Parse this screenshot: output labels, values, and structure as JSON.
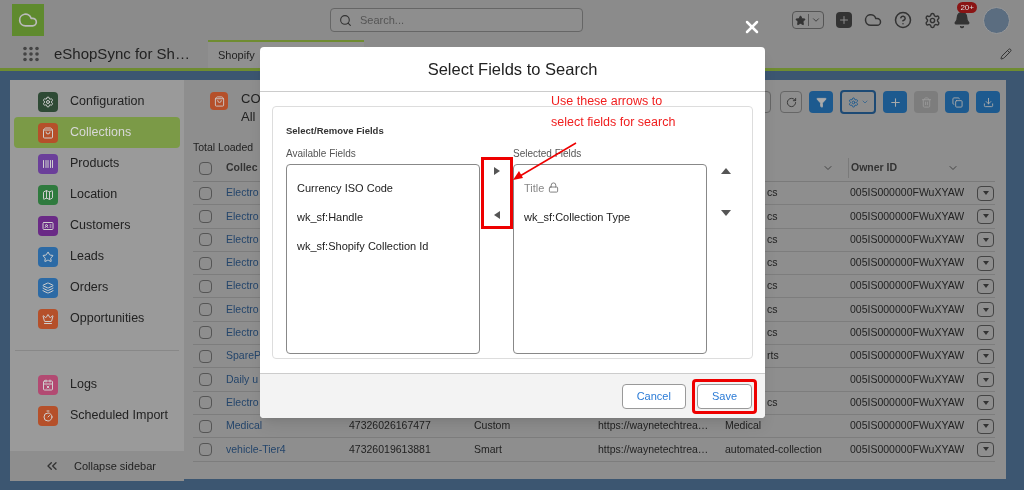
{
  "header": {
    "search": {
      "placeholder": "Search..."
    },
    "notification_badge": "20+"
  },
  "nav": {
    "app_name": "eShopSync for Sh…",
    "tabs": [
      {
        "label": "Shopify",
        "selected": true
      }
    ]
  },
  "sidebar": {
    "items": [
      {
        "label": "Configuration",
        "selected": false,
        "color": "#2e4a35"
      },
      {
        "label": "Collections",
        "selected": true,
        "color": "#b5502a"
      },
      {
        "label": "Products",
        "selected": false,
        "color": "#6b3f9a"
      },
      {
        "label": "Location",
        "selected": false,
        "color": "#2f7a3e"
      },
      {
        "label": "Customers",
        "selected": false,
        "color": "#6a2a86"
      },
      {
        "label": "Leads",
        "selected": false,
        "color": "#2c6aa5"
      },
      {
        "label": "Orders",
        "selected": false,
        "color": "#2c6aa5"
      },
      {
        "label": "Opportunities",
        "selected": false,
        "color": "#b5502a"
      }
    ],
    "footer_items": [
      {
        "label": "Logs",
        "selected": false,
        "color": "#b24a72"
      },
      {
        "label": "Scheduled Import",
        "selected": false,
        "color": "#b5502a"
      }
    ],
    "collapse": "Collapse sidebar"
  },
  "main": {
    "title": "CO",
    "subtitle": "All",
    "total_loaded": "Total Loaded"
  },
  "table": {
    "select_all": {
      "checked": false
    },
    "columns": [
      {
        "label": "Collec"
      },
      {
        "label": "Owner ID"
      }
    ],
    "rows": [
      {
        "checked": false,
        "name": "Electro",
        "col_5": "cs",
        "owner_id": "005IS000000FWuXYAW"
      },
      {
        "checked": false,
        "name": "Electro",
        "col_5": "cs",
        "owner_id": "005IS000000FWuXYAW"
      },
      {
        "checked": false,
        "name": "Electro",
        "col_5": "cs",
        "owner_id": "005IS000000FWuXYAW"
      },
      {
        "checked": false,
        "name": "Electro",
        "col_5": "cs",
        "owner_id": "005IS000000FWuXYAW"
      },
      {
        "checked": false,
        "name": "Electro",
        "col_5": "cs",
        "owner_id": "005IS000000FWuXYAW"
      },
      {
        "checked": false,
        "name": "Electro",
        "col_5": "cs",
        "owner_id": "005IS000000FWuXYAW"
      },
      {
        "checked": false,
        "name": "Electro",
        "col_5": "cs",
        "owner_id": "005IS000000FWuXYAW"
      },
      {
        "checked": false,
        "name": "SpareP",
        "col_5": "rts",
        "owner_id": "005IS000000FWuXYAW"
      },
      {
        "checked": false,
        "name": "Daily u",
        "owner_id": "005IS000000FWuXYAW"
      },
      {
        "checked": false,
        "name": "Electro",
        "col_5": "cs",
        "owner_id": "005IS000000FWuXYAW"
      },
      {
        "checked": false,
        "name": "Medical",
        "id": "47326026167477",
        "type": "Custom",
        "url": "https://waynetechtrea…",
        "col_5": "Medical",
        "owner_id": "005IS000000FWuXYAW"
      },
      {
        "checked": false,
        "name": "vehicle-Tier4",
        "id": "47326019613881",
        "type": "Smart",
        "url": "https://waynetechtrea…",
        "col_5": "automated-collection",
        "owner_id": "005IS000000FWuXYAW"
      }
    ]
  },
  "dialog": {
    "title": "Select Fields to Search",
    "section": "Select/Remove Fields",
    "available": {
      "label": "Available Fields",
      "items": [
        {
          "label": "Currency ISO Code",
          "locked": false
        },
        {
          "label": "wk_sf:Handle",
          "locked": false
        },
        {
          "label": "wk_sf:Shopify Collection Id",
          "locked": false
        }
      ]
    },
    "selected": {
      "label": "Selected Fields",
      "items": [
        {
          "label": "Title",
          "locked": true
        },
        {
          "label": "wk_sf:Collection Type",
          "locked": false
        }
      ]
    },
    "buttons": [
      {
        "label": "Cancel",
        "highlighted": false
      },
      {
        "label": "Save",
        "highlighted": true
      }
    ]
  },
  "annotation": {
    "lines": [
      "Use these arrows to",
      "select fields for search"
    ]
  }
}
